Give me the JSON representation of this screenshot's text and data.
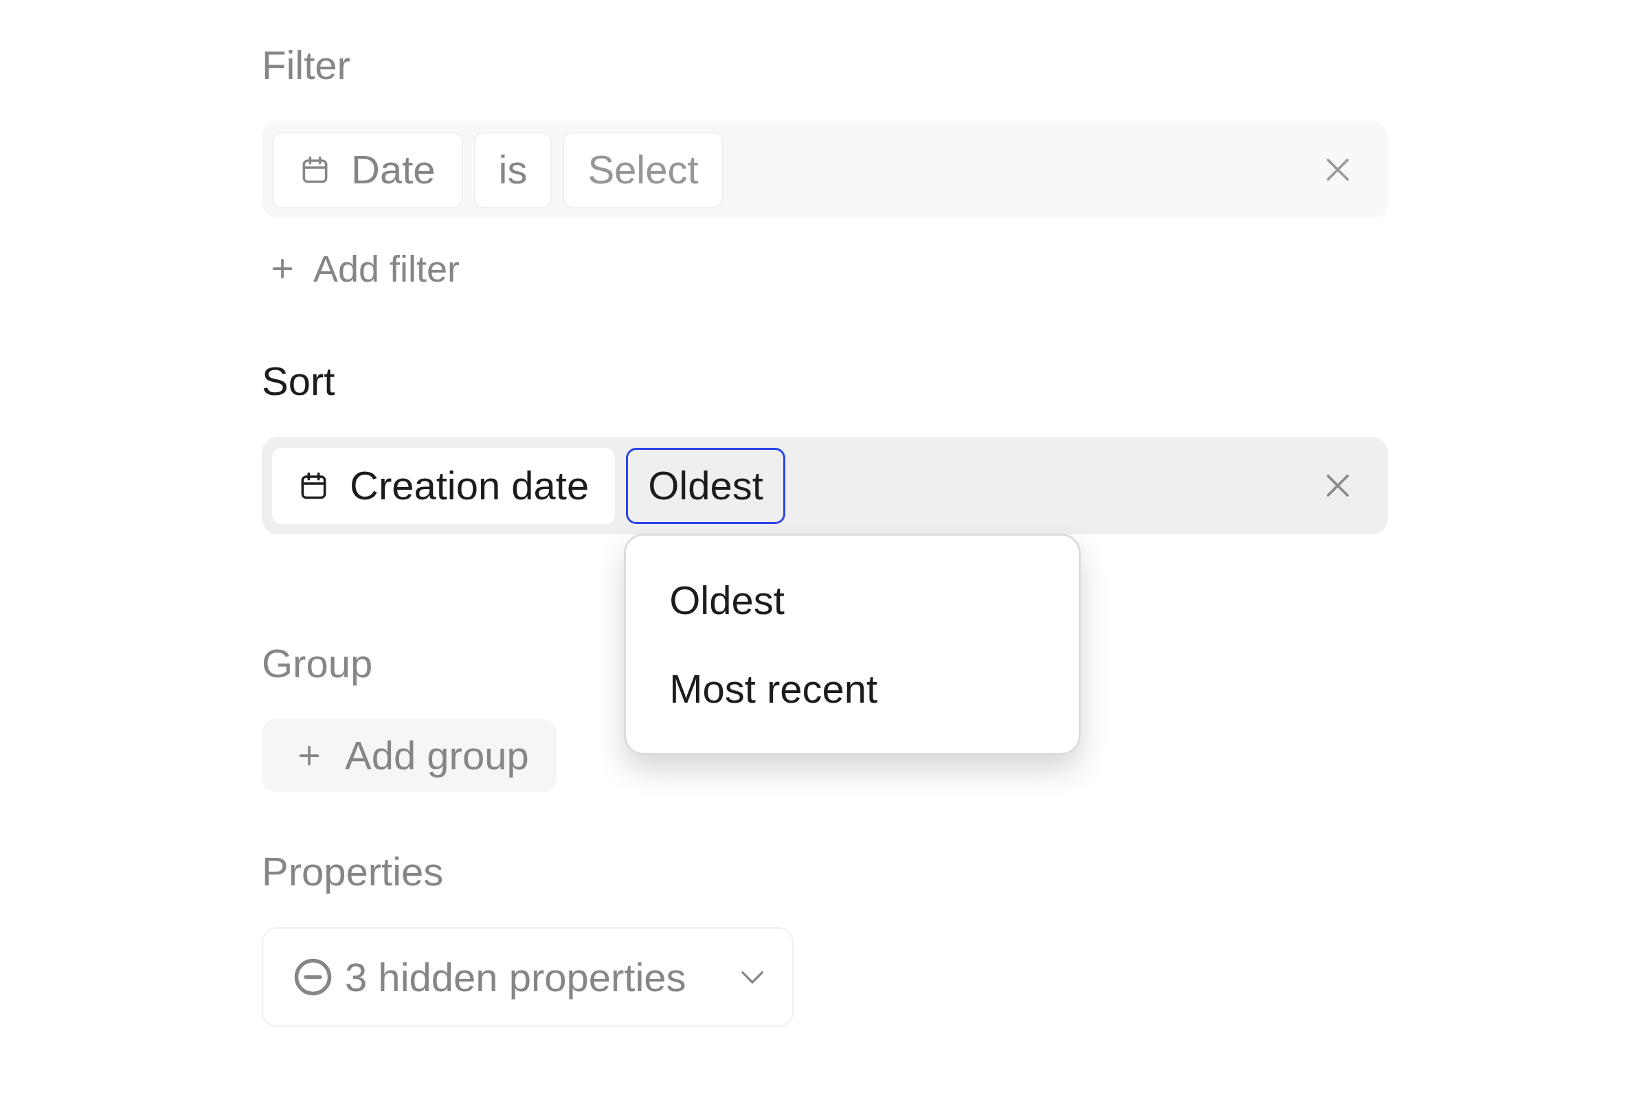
{
  "filter": {
    "title": "Filter",
    "dimmed": true,
    "field": "Date",
    "operator": "is",
    "value": {
      "placeholder": "Select"
    },
    "add_button": "Add filter"
  },
  "sort": {
    "title": "Sort",
    "dimmed": false,
    "field": "Creation date",
    "direction": {
      "label": "Oldest",
      "expanded": true,
      "options": [
        {
          "label": "Oldest",
          "selected": false
        },
        {
          "label": "Most recent",
          "selected": false
        }
      ]
    }
  },
  "group": {
    "title": "Group",
    "dimmed": true,
    "add_button": "Add group"
  },
  "properties": {
    "title": "Properties",
    "dimmed": true,
    "dropdown": "3 hidden properties"
  }
}
